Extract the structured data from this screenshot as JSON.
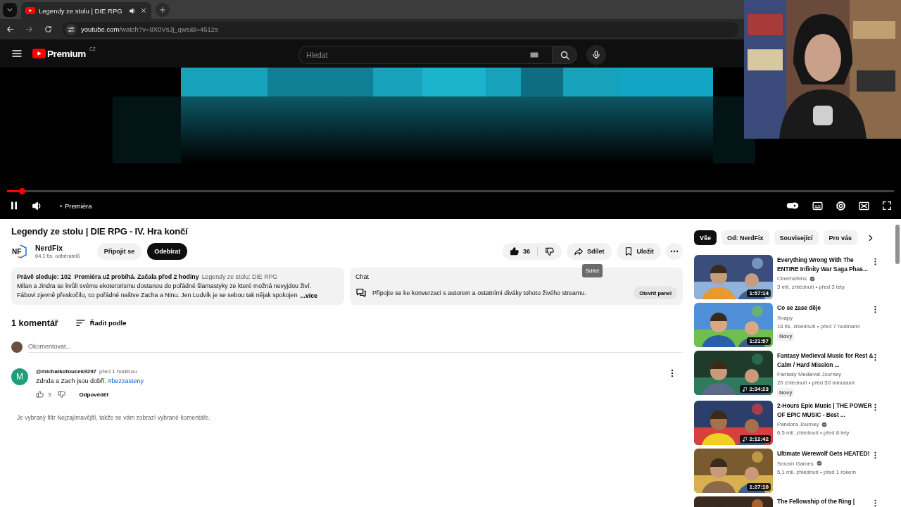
{
  "browser": {
    "tab": {
      "title": "Legendy ze stolu | DIE RPG",
      "audio": true
    },
    "url": {
      "host": "youtube.com",
      "path": "/watch?v=8X0VsJj_qws&t=4512s"
    }
  },
  "header": {
    "logo": "Premium",
    "region": "CZ",
    "search": {
      "placeholder": "Hledat"
    }
  },
  "player": {
    "progress": {
      "level": 0.017
    },
    "status": "Premiéra"
  },
  "video": {
    "title": "Legendy ze stolu | DIE RPG - IV. Hra končí",
    "channel": {
      "avatar": "NF",
      "name": "NerdFix",
      "subscribers": "64,1 tis. odběratelů"
    },
    "join": "Připojit se",
    "subscribe": "Odebírat",
    "likes": "36",
    "share": "Sdílet",
    "save": "Uložit",
    "tooltip": "Sdílet"
  },
  "description": {
    "meta": "Právě sleduje: 102  Premiéra už probíhá. Začala před 2 hodiny",
    "playlist": "Legendy ze stolu: DIE RPG",
    "lines": [
      "Milan a Jindra se kvůli svému ekoterorismu dostanou do pořádné šlamastyky ze které možná nevyjdou živí.",
      "Fábovi zjevně přeskočilo, co pořádné naštve Zacha a Ninu. Jen Ludvík je se sebou tak nějak spokojen"
    ],
    "more": "...více"
  },
  "chat": {
    "title": "Chat",
    "text": "Připojte se ke konverzaci s autorem a ostatními diváky tohoto živého streamu.",
    "button": "Otevřít panel"
  },
  "comments": {
    "count": "1 komentář",
    "sort": "Řadit podle",
    "placeholder": "Okomentovat...",
    "items": [
      {
        "avatar": "M",
        "author": "@michalkotoucek9297",
        "time": "před 1 hodinou",
        "text": "Zdnda a Zach jsou dobří.",
        "hashtag": "#bezzasteny",
        "likes": "3",
        "reply": "Odpovědět"
      }
    ],
    "note": "Je vybraný filtr Nejzajímavější, takže se vám zobrazí vybrané komentáře."
  },
  "chips": [
    {
      "label": "Vše",
      "selected": true
    },
    {
      "label": "Od: NerdFix",
      "selected": false
    },
    {
      "label": "Související",
      "selected": false
    },
    {
      "label": "Pro vás",
      "selected": false
    }
  ],
  "recommended": [
    {
      "title": "Everything Wrong With The ENTIRE Infinity War Saga Phas...",
      "channel": "CinemaSins",
      "verified": true,
      "stats": "3 mil. zhlédnutí • před 3 lety",
      "duration": "1:57:14",
      "music": false
    },
    {
      "title": "Co se zase děje",
      "channel": "Xnapy",
      "verified": false,
      "stats": "16 tis. zhlédnutí • před 7 hodinami",
      "badge": "Nový",
      "duration": "1:21:57",
      "music": false
    },
    {
      "title": "Fantasy Medieval Music for Rest & Calm / Hard Mission ...",
      "channel": "Fantasy Medieval Journey",
      "verified": false,
      "stats": "20 zhlédnutí • před 50 minutami",
      "badge": "Nový",
      "duration": "2:34:23",
      "music": true
    },
    {
      "title": "2-Hours Epic Music | THE POWER OF EPIC MUSIC - Best ...",
      "channel": "Pandora Journey",
      "verified": true,
      "stats": "6,5 mil. zhlédnutí • před 8 lety",
      "duration": "2:12:42",
      "music": true
    },
    {
      "title": "Ultimate Werewolf Gets HEATED!",
      "channel": "Smosh Games",
      "verified": true,
      "stats": "5,1 mil. zhlédnutí • před 1 rokem",
      "duration": "1:27:10",
      "music": false
    },
    {
      "title": "The Fellowship of the Ring |"
    }
  ]
}
